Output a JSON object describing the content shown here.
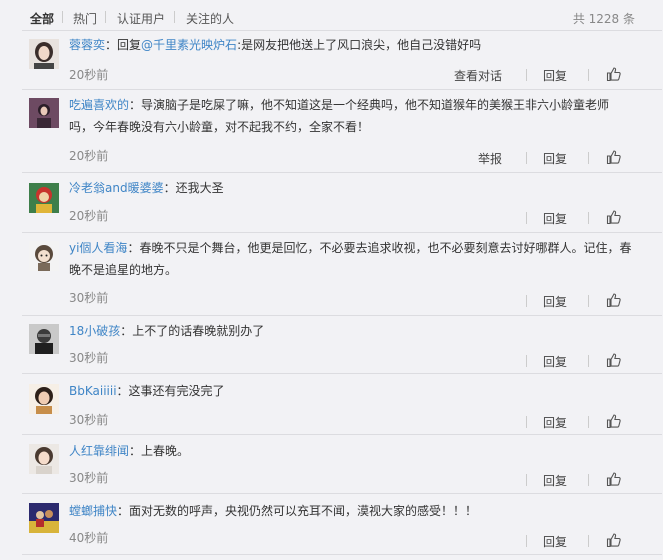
{
  "tabs": [
    "全部",
    "热门",
    "认证用户",
    "关注的人"
  ],
  "total": "共 1228 条",
  "actions": {
    "reply": "回复",
    "view_dialog": "查看对话",
    "report": "举报",
    "like_icon": "thumbs-up-icon"
  },
  "colors": {
    "username": "#eb7350",
    "username_alt": "#3f85c6",
    "background": "#f2f2f5"
  },
  "comments": [
    {
      "user": "蓉蓉奕",
      "sep": "：",
      "prefix": "回复",
      "mention": "@千里素光映炉石",
      "text": ":是网友把他送上了风口浪尖，他自己没错好吗",
      "time": "20秒前",
      "extra": "查看对话"
    },
    {
      "user": "吃遍喜欢的",
      "sep": "：",
      "text": "导演脑子是吃屎了嘛，他不知道这是一个经典吗，他不知道猴年的美猴王非六小龄童老师",
      "text2": "吗，今年春晚没有六小龄童，对不起我不约，全家不看！",
      "time": "20秒前",
      "extra": "举报"
    },
    {
      "user": "冷老翁and暖婆婆",
      "sep": "：",
      "text": "还我大圣",
      "time": "20秒前"
    },
    {
      "user": "yi個人看海",
      "sep": "：",
      "text": "春晚不只是个舞台，他更是回忆，不必要去追求收视，也不必要刻意去讨好哪群人。记住，春",
      "text2": "晚不是追星的地方。",
      "time": "30秒前"
    },
    {
      "user": "18小破孩",
      "sep": "：",
      "text": "上不了的话春晚就别办了",
      "time": "30秒前"
    },
    {
      "user": "BbKaiiiii",
      "sep": "：",
      "text": "这事还有完没完了",
      "time": "30秒前"
    },
    {
      "user": "人红靠绯闻",
      "sep": "：",
      "text": "上春晚。",
      "time": "30秒前"
    },
    {
      "user": "螳螂捕快",
      "sep": "：",
      "text": "面对无数的呼声，央视仍然可以充耳不闻，漠视大家的感受！！！",
      "time": "40秒前"
    }
  ]
}
